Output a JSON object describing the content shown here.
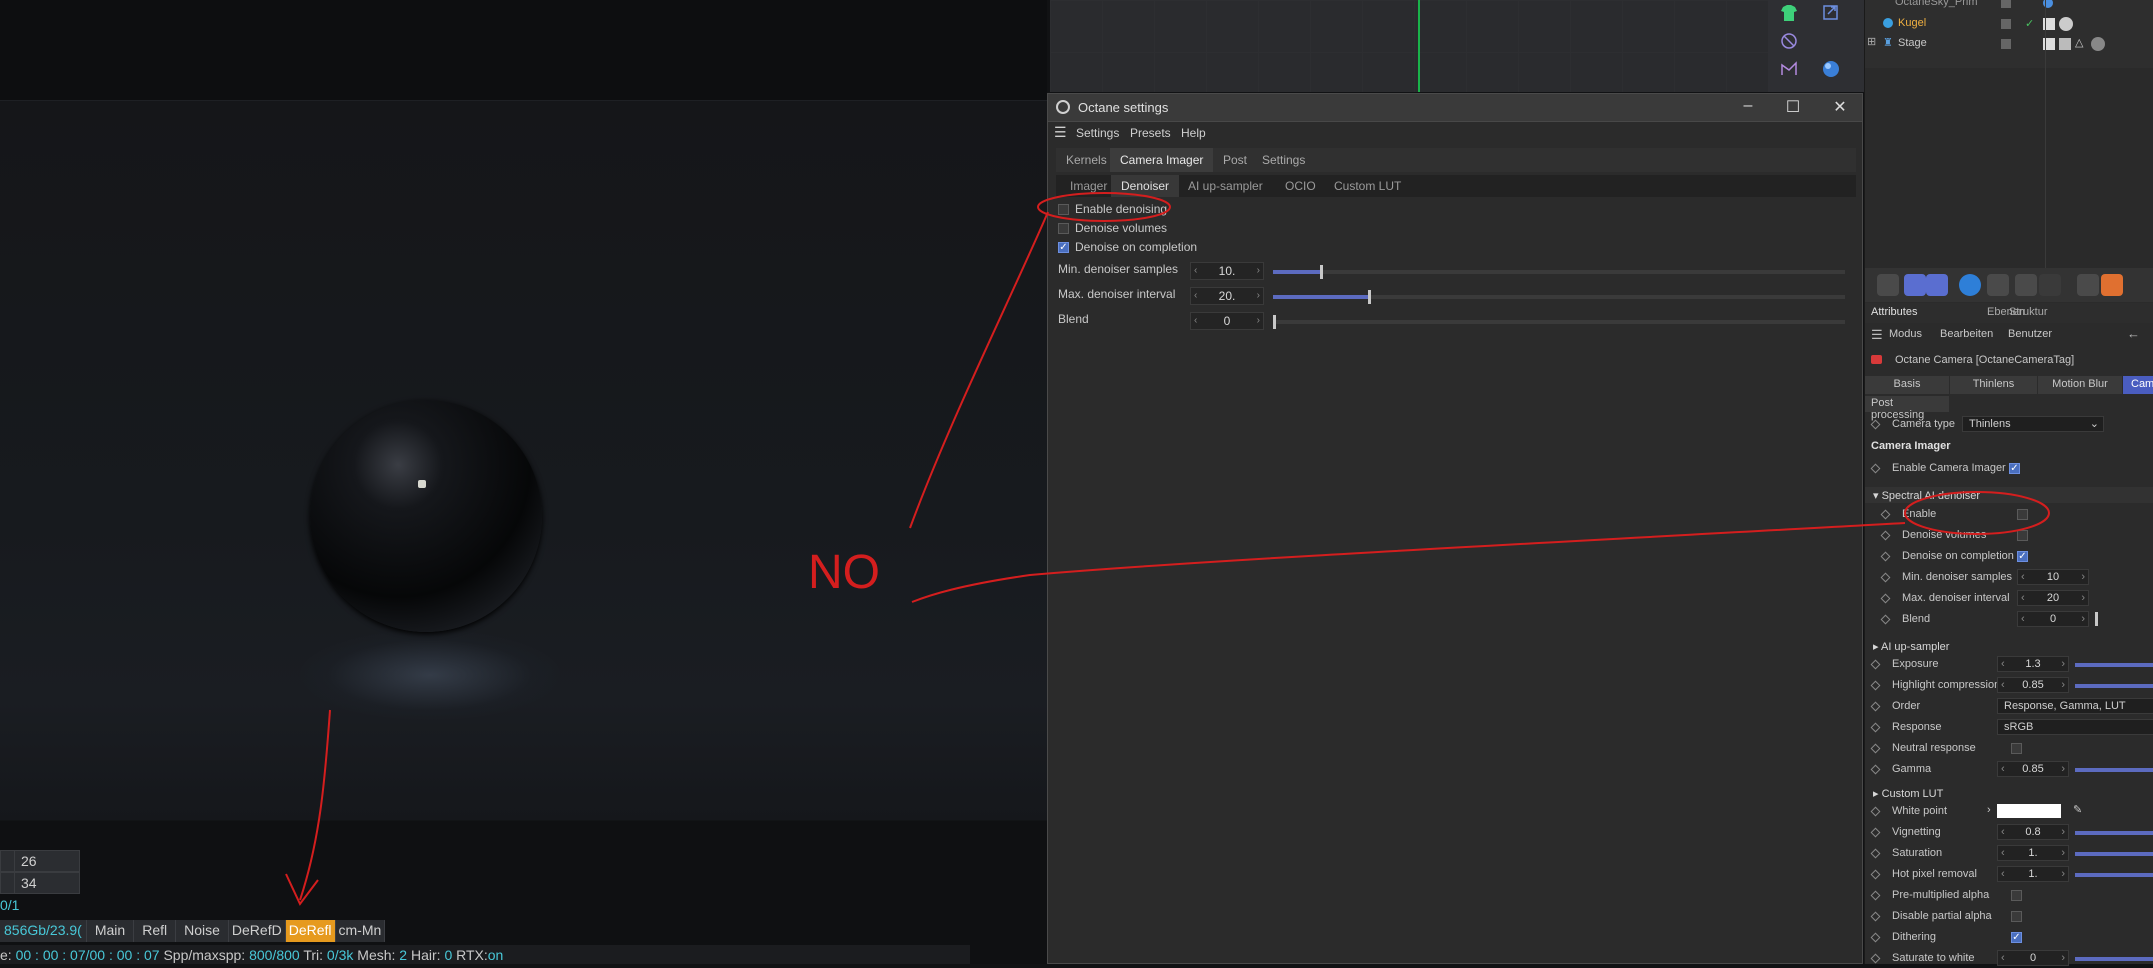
{
  "viewport": {
    "stats": [
      "26",
      "34"
    ],
    "sample_row": "0/1",
    "mem": "856Gb/23.9(",
    "tabs": [
      "Main",
      "Refl",
      "Noise",
      "DeRefD",
      "DeRefl",
      "cm-Mn"
    ],
    "active_tab": "DeRefl",
    "status": {
      "time_label": "e: ",
      "time_value": "00 : 00 : 07/00 : 00 : 07",
      "spp_label": "  Spp/maxspp: ",
      "spp_value": "800/800",
      "tri_label": "  Tri: ",
      "tri_value": "0/3k",
      "mesh_label": "  Mesh: ",
      "mesh_value": "2",
      "hair_label": "  Hair: ",
      "hair_value": "0",
      "rtx_label": "   RTX:",
      "rtx_value": "on"
    }
  },
  "annotation": {
    "no_text": "NO"
  },
  "octane": {
    "title": "Octane settings",
    "menu": [
      "Settings",
      "Presets",
      "Help"
    ],
    "tabs": [
      "Kernels",
      "Camera Imager",
      "Post",
      "Settings"
    ],
    "active_tab": "Camera Imager",
    "subtabs": [
      "Imager",
      "Denoiser",
      "AI up-sampler",
      "OCIO",
      "Custom LUT"
    ],
    "active_subtab": "Denoiser",
    "checks": [
      {
        "label": "Enable denoising",
        "checked": false
      },
      {
        "label": "Denoise volumes",
        "checked": false
      },
      {
        "label": "Denoise on completion",
        "checked": true
      }
    ],
    "spins": [
      {
        "label": "Min. denoiser samples",
        "value": "10.",
        "fraction": 0.085
      },
      {
        "label": "Max. denoiser interval",
        "value": "20.",
        "fraction": 0.17
      },
      {
        "label": "Blend",
        "value": "0",
        "fraction": 0.0
      }
    ]
  },
  "objects": {
    "rows": [
      "OctaneSky_Prim",
      "Kugel",
      "Stage"
    ]
  },
  "attributes": {
    "tabs": [
      "Attributes",
      "Ebenen",
      "Struktur"
    ],
    "menu": [
      "Modus",
      "Bearbeiten",
      "Benutzer"
    ],
    "object_title": "Octane Camera [OctaneCameraTag]",
    "cam_tabs": [
      "Basis",
      "Thinlens",
      "Motion Blur",
      "Camer"
    ],
    "post_processing": "Post processing",
    "camera_type_label": "Camera type",
    "camera_type_value": "Thinlens",
    "camera_imager_heading": "Camera Imager",
    "enable_camera_imager": "Enable Camera Imager",
    "spectral_section": "Spectral AI denoiser",
    "spectral_rows": [
      {
        "label": "Enable",
        "kind": "check",
        "checked": false
      },
      {
        "label": "Denoise volumes",
        "kind": "check",
        "checked": false
      },
      {
        "label": "Denoise on completion",
        "kind": "check",
        "checked": true
      },
      {
        "label": "Min. denoiser samples",
        "kind": "spin",
        "value": "10"
      },
      {
        "label": "Max. denoiser interval",
        "kind": "spin",
        "value": "20"
      },
      {
        "label": "Blend",
        "kind": "spin",
        "value": "0"
      }
    ],
    "upsampler_section": "AI up-sampler",
    "imager_rows": [
      {
        "label": "Exposure",
        "kind": "spin",
        "value": "1.3"
      },
      {
        "label": "Highlight compression",
        "kind": "spin",
        "value": "0.85"
      },
      {
        "label": "Order",
        "kind": "drop",
        "value": "Response, Gamma, LUT"
      },
      {
        "label": "Response",
        "kind": "drop",
        "value": "sRGB"
      },
      {
        "label": "Neutral response",
        "kind": "check",
        "checked": false
      },
      {
        "label": "Gamma",
        "kind": "spin",
        "value": "0.85"
      }
    ],
    "lut_section": "Custom LUT",
    "lut_rows": [
      {
        "label": "White point",
        "kind": "color"
      },
      {
        "label": "Vignetting",
        "kind": "spin",
        "value": "0.8"
      },
      {
        "label": "Saturation",
        "kind": "spin",
        "value": "1."
      },
      {
        "label": "Hot pixel removal",
        "kind": "spin",
        "value": "1."
      },
      {
        "label": "Pre-multiplied alpha",
        "kind": "check",
        "checked": false
      },
      {
        "label": "Disable partial alpha",
        "kind": "check",
        "checked": false
      },
      {
        "label": "Dithering",
        "kind": "check",
        "checked": true
      },
      {
        "label": "Saturate to white",
        "kind": "spin",
        "value": "0"
      }
    ]
  },
  "colors": {
    "accent_orange": "#e69a1e",
    "accent_blue": "#5c6bc0",
    "annotation_red": "#d41e1e",
    "axis_green": "#19b34a"
  }
}
